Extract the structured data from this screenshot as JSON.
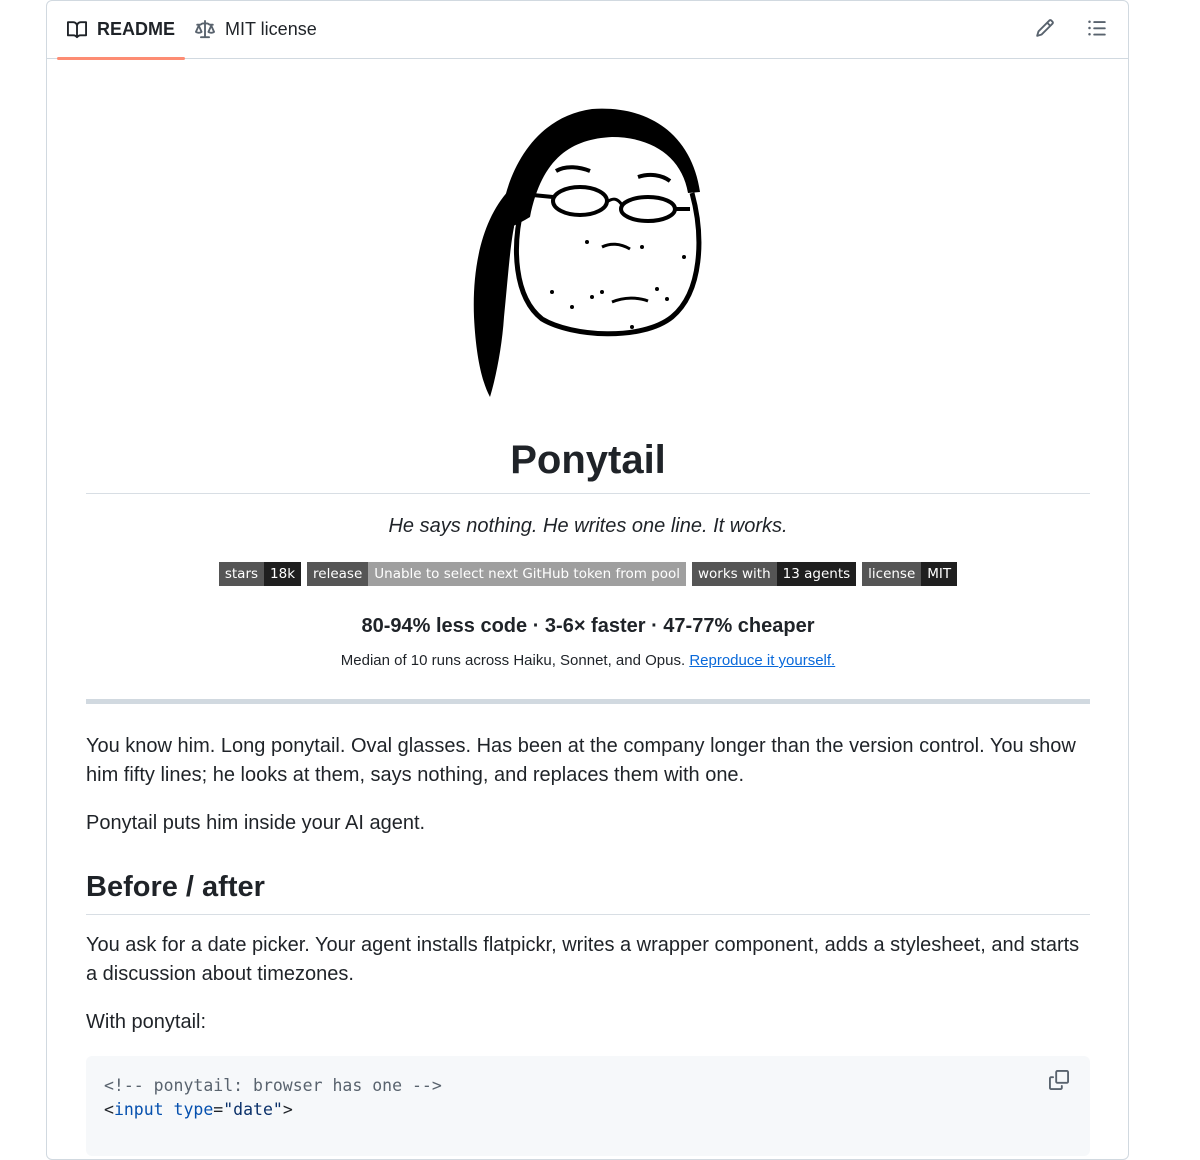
{
  "tabs": [
    {
      "label": "README",
      "icon": "book-icon",
      "active": true
    },
    {
      "label": "MIT license",
      "icon": "scale-icon",
      "active": false
    }
  ],
  "actions": {
    "edit_icon": "pencil-icon",
    "outline_icon": "list-icon"
  },
  "readme": {
    "title": "Ponytail",
    "tagline": "He says nothing. He writes one line. It works.",
    "badges": [
      {
        "label": "stars",
        "value": "18k",
        "value_color": "#1f1f1f"
      },
      {
        "label": "release",
        "value": "Unable to select next GitHub token from pool",
        "value_color": "#9f9f9f"
      },
      {
        "label": "works with",
        "value": "13 agents",
        "value_color": "#1f1f1f"
      },
      {
        "label": "license",
        "value": "MIT",
        "value_color": "#1f1f1f"
      }
    ],
    "stats": "80-94% less code · 3-6× faster · 47-77% cheaper",
    "median_text": "Median of 10 runs across Haiku, Sonnet, and Opus.",
    "median_link": "Reproduce it yourself.",
    "para1": "You know him. Long ponytail. Oval glasses. Has been at the company longer than the version control. You show him fifty lines; he looks at them, says nothing, and replaces them with one.",
    "para2": "Ponytail puts him inside your AI agent.",
    "section_heading": "Before / after",
    "para3": "You ask for a date picker. Your agent installs flatpickr, writes a wrapper component, adds a stylesheet, and starts a discussion about timezones.",
    "para4": "With ponytail:",
    "code": {
      "comment": "<!-- ponytail: browser has one -->",
      "open": "<",
      "tag": "input",
      "space": " ",
      "attr": "type",
      "eq": "=",
      "value": "\"date\"",
      "close": ">",
      "copy_icon": "copy-icon"
    }
  },
  "colors": {
    "accent_underline": "#fd8c73",
    "link": "#0969da"
  }
}
